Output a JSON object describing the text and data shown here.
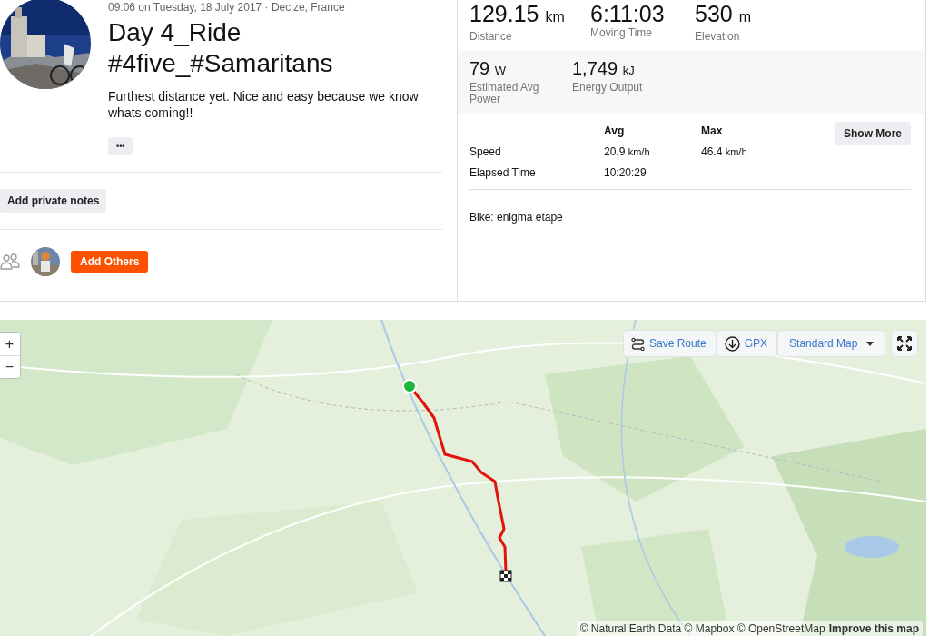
{
  "activity": {
    "meta": "09:06 on Tuesday, 18 July 2017 · Decize, France",
    "title_lines": [
      "Day 4_Ride",
      "#4five_#Samaritans"
    ],
    "description": "Furthest distance yet. Nice and easy because we know whats coming!!",
    "more_button": "•••",
    "private_notes_button": "Add private notes",
    "add_others_button": "Add Others"
  },
  "stats": {
    "primary": [
      {
        "value": "129.15",
        "unit": "km",
        "label": "Distance"
      },
      {
        "value": "6:11:03",
        "label": "Moving Time"
      },
      {
        "value": "530",
        "unit": "m",
        "label": "Elevation"
      }
    ],
    "secondary": [
      {
        "value": "79",
        "unit": "W",
        "label": "Estimated Avg Power"
      },
      {
        "value": "1,749",
        "unit": "kJ",
        "label": "Energy Output"
      }
    ],
    "table": {
      "columns": [
        "Avg",
        "Max"
      ],
      "rows": [
        {
          "label": "Speed",
          "avg": "20.9",
          "avg_unit": "km/h",
          "max": "46.4",
          "max_unit": "km/h"
        },
        {
          "label": "Elapsed Time",
          "avg": "10:20:29"
        }
      ]
    },
    "show_more_button": "Show More",
    "bike": "Bike: enigma etape"
  },
  "map": {
    "zoom_in": "+",
    "zoom_out": "−",
    "save_route": "Save Route",
    "gpx": "GPX",
    "map_style": "Standard Map",
    "attribution": "© Natural Earth Data © Mapbox © OpenStreetMap",
    "improve_link": "Improve this map"
  }
}
